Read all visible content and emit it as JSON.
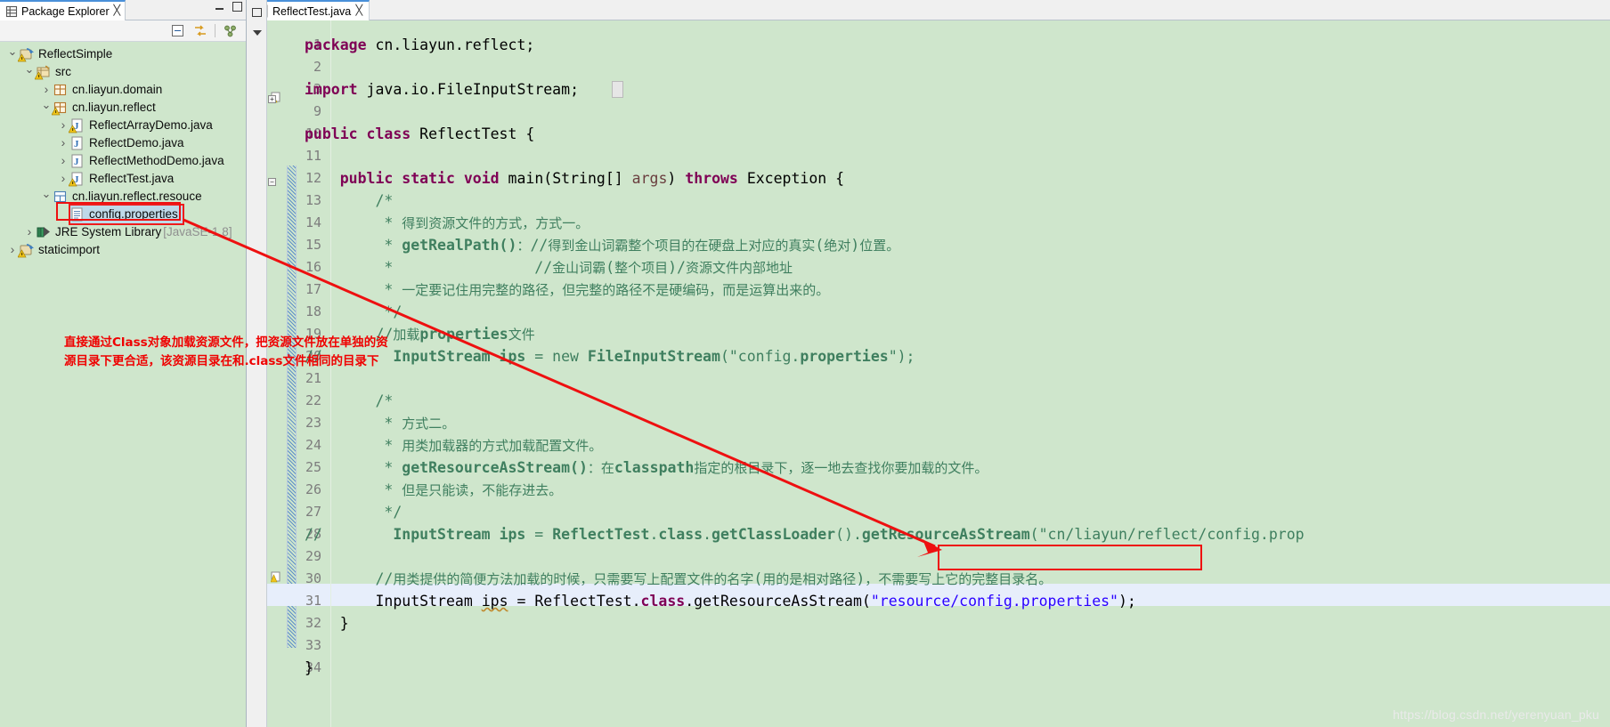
{
  "explorer": {
    "tab": {
      "label": "Package Explorer",
      "close_glyph": "╳",
      "icon": "package-explorer-icon"
    },
    "window_controls": {
      "minimize": "minimize-icon",
      "maximize": "maximize-icon"
    },
    "toolbar": [
      {
        "name": "collapse-all-icon",
        "tooltip": "Collapse All"
      },
      {
        "name": "link-with-editor-icon",
        "tooltip": "Link with Editor"
      },
      {
        "name": "view-menu-icon",
        "tooltip": "View Menu"
      }
    ],
    "tree": [
      {
        "label": "ReflectSimple",
        "suffix": "",
        "depth": 0,
        "twist": "open",
        "icon": "java-project-icon",
        "selected": false,
        "warn": true
      },
      {
        "label": "src",
        "suffix": "",
        "depth": 1,
        "twist": "open",
        "icon": "source-folder-icon",
        "selected": false,
        "warn": true
      },
      {
        "label": "cn.liayun.domain",
        "suffix": "",
        "depth": 2,
        "twist": "closed",
        "icon": "package-icon",
        "selected": false,
        "warn": false
      },
      {
        "label": "cn.liayun.reflect",
        "suffix": "",
        "depth": 2,
        "twist": "open",
        "icon": "package-icon",
        "selected": false,
        "warn": true
      },
      {
        "label": "ReflectArrayDemo.java",
        "suffix": "",
        "depth": 3,
        "twist": "closed",
        "icon": "java-file-icon",
        "selected": false,
        "warn": true
      },
      {
        "label": "ReflectDemo.java",
        "suffix": "",
        "depth": 3,
        "twist": "closed",
        "icon": "java-file-icon",
        "selected": false,
        "warn": false
      },
      {
        "label": "ReflectMethodDemo.java",
        "suffix": "",
        "depth": 3,
        "twist": "closed",
        "icon": "java-file-icon",
        "selected": false,
        "warn": false
      },
      {
        "label": "ReflectTest.java",
        "suffix": "",
        "depth": 3,
        "twist": "closed",
        "icon": "java-file-icon",
        "selected": false,
        "warn": true
      },
      {
        "label": "cn.liayun.reflect.resouce",
        "suffix": "",
        "depth": 2,
        "twist": "open",
        "icon": "resource-package-icon",
        "selected": false,
        "warn": false
      },
      {
        "label": "config.properties",
        "suffix": "",
        "depth": 3,
        "twist": "none",
        "icon": "properties-file-icon",
        "selected": true,
        "warn": false
      },
      {
        "label": "JRE System Library",
        "suffix": " [JavaSE-1.8]",
        "depth": 1,
        "twist": "closed",
        "icon": "jre-library-icon",
        "selected": false,
        "warn": false
      },
      {
        "label": "staticimport",
        "suffix": "",
        "depth": 0,
        "twist": "closed",
        "icon": "java-project-icon",
        "selected": false,
        "warn": true
      }
    ]
  },
  "ministrip": {
    "restore_button": "restore-icon",
    "menu_button": "view-menu-arrow-icon"
  },
  "editor": {
    "tab": {
      "label": "ReflectTest.java",
      "close_glyph": "╳",
      "icon": "java-file-icon"
    },
    "lines": [
      {
        "n": "1",
        "text": "package cn.liayun.reflect;"
      },
      {
        "n": "2",
        "text": ""
      },
      {
        "n": "3",
        "text": "import java.io.FileInputStream;"
      },
      {
        "n": "9",
        "text": ""
      },
      {
        "n": "10",
        "text": "public class ReflectTest {"
      },
      {
        "n": "11",
        "text": ""
      },
      {
        "n": "12",
        "text": "    public static void main(String[] args) throws Exception {"
      },
      {
        "n": "13",
        "text": "        /*"
      },
      {
        "n": "14",
        "text": "         * 得到资源文件的方式，方式一。"
      },
      {
        "n": "15",
        "text": "         * getRealPath()：//得到金山词霸整个项目的在硬盘上对应的真实(绝对)位置。"
      },
      {
        "n": "16",
        "text": "         *                //金山词霸(整个项目)/资源文件内部地址"
      },
      {
        "n": "17",
        "text": "         * 一定要记住用完整的路径，但完整的路径不是硬编码，而是运算出来的。"
      },
      {
        "n": "18",
        "text": "         */"
      },
      {
        "n": "19",
        "text": "        //加载properties文件"
      },
      {
        "n": "20",
        "text": "//        InputStream ips = new FileInputStream(\"config.properties\");"
      },
      {
        "n": "21",
        "text": ""
      },
      {
        "n": "22",
        "text": "        /*"
      },
      {
        "n": "23",
        "text": "         * 方式二。"
      },
      {
        "n": "24",
        "text": "         * 用类加载器的方式加载配置文件。"
      },
      {
        "n": "25",
        "text": "         * getResourceAsStream()：在classpath指定的根目录下，逐一地去查找你要加载的文件。"
      },
      {
        "n": "26",
        "text": "         * 但是只能读，不能存进去。"
      },
      {
        "n": "27",
        "text": "         */"
      },
      {
        "n": "28",
        "text": "//        InputStream ips = ReflectTest.class.getClassLoader().getResourceAsStream(\"cn/liayun/reflect/config.prop"
      },
      {
        "n": "29",
        "text": ""
      },
      {
        "n": "30",
        "text": "        //用类提供的简便方法加载的时候，只需要写上配置文件的名字(用的是相对路径)，不需要写上它的完整目录名。"
      },
      {
        "n": "31",
        "text": "        InputStream ips = ReflectTest.class.getResourceAsStream(\"resource/config.properties\");"
      },
      {
        "n": "32",
        "text": "    }"
      },
      {
        "n": "33",
        "text": ""
      },
      {
        "n": "34",
        "text": "}"
      }
    ],
    "highlighted_string": "resource/config.properties",
    "import_collapsed_marker": "…"
  },
  "annotations": {
    "note_line1": "直接通过Class对象加载资源文件，把资源文件放在单独的资",
    "note_line2": "源目录下更合适，该资源目录在和.class文件相同的目录下",
    "note_color": "#ef0000",
    "arrow_color": "#ee1010",
    "highlight_box_color": "#ee1010"
  },
  "watermark": {
    "text": "https://blog.csdn.net/yerenyuan_pku"
  }
}
